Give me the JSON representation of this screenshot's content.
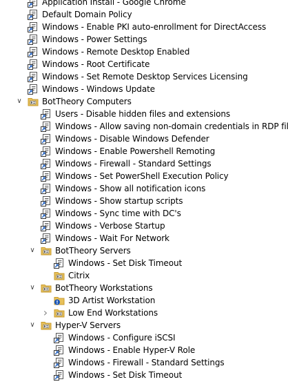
{
  "tree": {
    "rows": [
      {
        "label": "Application Install - Google Chrome",
        "kind": "gpo-link",
        "level": 1
      },
      {
        "label": "Default Domain Policy",
        "kind": "gpo-link",
        "level": 1
      },
      {
        "label": "Windows - Enable PKI auto-enrollment for DirectAccess",
        "kind": "gpo-link",
        "level": 1
      },
      {
        "label": "Windows - Power Settings",
        "kind": "gpo-link",
        "level": 1
      },
      {
        "label": "Windows - Remote Desktop Enabled",
        "kind": "gpo-link",
        "level": 1
      },
      {
        "label": "Windows - Root Certificate",
        "kind": "gpo-link",
        "level": 1
      },
      {
        "label": "Windows - Set Remote Desktop Services Licensing",
        "kind": "gpo-link",
        "level": 1
      },
      {
        "label": "Windows - Windows Update",
        "kind": "gpo-link",
        "level": 1
      },
      {
        "label": "BotTheory Computers",
        "kind": "ou",
        "level": 1,
        "expander": "expanded"
      },
      {
        "label": "Users - Disable hidden files and extensions",
        "kind": "gpo-link",
        "level": 2
      },
      {
        "label": "Windows - Allow saving non-domain credentials in RDP files",
        "kind": "gpo-link",
        "level": 2
      },
      {
        "label": "Windows - Disable Windows Defender",
        "kind": "gpo-link",
        "level": 2
      },
      {
        "label": "Windows - Enable Powershell Remoting",
        "kind": "gpo-link",
        "level": 2
      },
      {
        "label": "Windows - Firewall - Standard Settings",
        "kind": "gpo-link",
        "level": 2
      },
      {
        "label": "Windows - Set PowerShell Execution Policy",
        "kind": "gpo-link",
        "level": 2
      },
      {
        "label": "Windows - Show all notification icons",
        "kind": "gpo-link",
        "level": 2
      },
      {
        "label": "Windows - Show startup scripts",
        "kind": "gpo-link",
        "level": 2
      },
      {
        "label": "Windows - Sync time with DC's",
        "kind": "gpo-link",
        "level": 2
      },
      {
        "label": "Windows - Verbose Startup",
        "kind": "gpo-link",
        "level": 2
      },
      {
        "label": "Windows - Wait For Network",
        "kind": "gpo-link",
        "level": 2
      },
      {
        "label": "BotTheory Servers",
        "kind": "ou",
        "level": 2,
        "expander": "expanded"
      },
      {
        "label": "Windows - Set Disk Timeout",
        "kind": "gpo-link",
        "level": 3
      },
      {
        "label": "Citrix",
        "kind": "ou",
        "level": 3
      },
      {
        "label": "BotTheory Workstations",
        "kind": "ou",
        "level": 2,
        "expander": "expanded"
      },
      {
        "label": "3D Artist Workstation",
        "kind": "ou-blocked",
        "level": 3
      },
      {
        "label": "Low End Workstations",
        "kind": "ou",
        "level": 3,
        "expander": "collapsed"
      },
      {
        "label": "Hyper-V Servers",
        "kind": "ou",
        "level": 2,
        "expander": "expanded"
      },
      {
        "label": "Windows - Configure iSCSI",
        "kind": "gpo-link",
        "level": 3
      },
      {
        "label": "Windows - Enable Hyper-V Role",
        "kind": "gpo-link",
        "level": 3
      },
      {
        "label": "Windows - Firewall - Standard Settings",
        "kind": "gpo-link",
        "level": 3
      },
      {
        "label": "Windows - Set Disk Timeout",
        "kind": "gpo-link",
        "level": 3
      }
    ]
  },
  "icons": {
    "gpo-link": "gpo-link-icon",
    "ou": "organizational-unit-folder-icon",
    "ou-blocked": "blocked-inheritance-ou-icon",
    "expanded": "chevron-down-icon",
    "collapsed": "chevron-right-icon"
  },
  "colors": {
    "folder": "#e8c15a",
    "folder_dark": "#c79a2e",
    "gpo_scroll": "#ffffff",
    "link_arrow": "#1f5fbf",
    "blocked_badge": "#1a56b8"
  }
}
